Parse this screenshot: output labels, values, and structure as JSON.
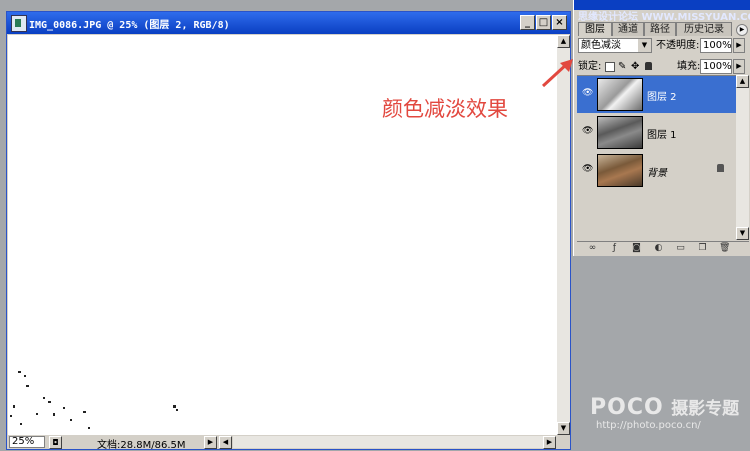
{
  "document": {
    "title": "IMG_0086.JPG @ 25% (图层 2, RGB/8)",
    "window_controls": [
      "_",
      "□",
      "×"
    ],
    "zoom": "25%",
    "doc_info": "文档:28.8M/86.5M"
  },
  "panel": {
    "tabs": [
      "图层",
      "通道",
      "路径",
      "历史记录"
    ],
    "blend_mode": "颜色减淡",
    "opacity_label": "不透明度:",
    "opacity_value": "100%",
    "lock_label": "锁定:",
    "fill_label": "填充:",
    "fill_value": "100%",
    "layers": [
      {
        "name": "图层 2",
        "selected": true
      },
      {
        "name": "图层 1",
        "selected": false
      },
      {
        "name": "背景",
        "selected": false
      }
    ]
  },
  "annotation": "颜色减淡效果",
  "watermark_top": "思缘设计论坛 WWW.MISSYUAN.COM",
  "poco": {
    "brand": "POCO",
    "title": "摄影专题",
    "url": "http://photo.poco.cn/"
  },
  "colors": {
    "annotation": "#e2483f",
    "selection": "#3a6fd0",
    "titlebar": "#0a3fc2"
  }
}
